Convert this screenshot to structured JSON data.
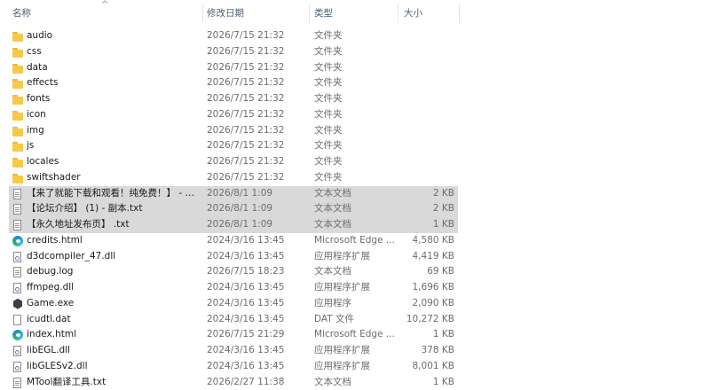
{
  "header": {
    "name": "名称",
    "date": "修改日期",
    "type": "类型",
    "size": "大小",
    "sort_indicator": "^"
  },
  "rows": [
    {
      "name": "audio",
      "date": "2026/7/15 21:32",
      "type": "文件夹",
      "size": "",
      "icon": "folder-icon",
      "selected": false
    },
    {
      "name": "css",
      "date": "2026/7/15 21:32",
      "type": "文件夹",
      "size": "",
      "icon": "folder-icon",
      "selected": false
    },
    {
      "name": "data",
      "date": "2026/7/15 21:32",
      "type": "文件夹",
      "size": "",
      "icon": "folder-icon",
      "selected": false
    },
    {
      "name": "effects",
      "date": "2026/7/15 21:32",
      "type": "文件夹",
      "size": "",
      "icon": "folder-icon",
      "selected": false
    },
    {
      "name": "fonts",
      "date": "2026/7/15 21:32",
      "type": "文件夹",
      "size": "",
      "icon": "folder-icon",
      "selected": false
    },
    {
      "name": "icon",
      "date": "2026/7/15 21:32",
      "type": "文件夹",
      "size": "",
      "icon": "folder-icon",
      "selected": false
    },
    {
      "name": "img",
      "date": "2026/7/15 21:32",
      "type": "文件夹",
      "size": "",
      "icon": "folder-icon",
      "selected": false
    },
    {
      "name": "js",
      "date": "2026/7/15 21:32",
      "type": "文件夹",
      "size": "",
      "icon": "folder-icon",
      "selected": false
    },
    {
      "name": "locales",
      "date": "2026/7/15 21:32",
      "type": "文件夹",
      "size": "",
      "icon": "folder-icon",
      "selected": false
    },
    {
      "name": "swiftshader",
      "date": "2026/7/15 21:32",
      "type": "文件夹",
      "size": "",
      "icon": "folder-icon",
      "selected": false
    },
    {
      "name": "【来了就能下载和观看！纯免费！】 - 副...",
      "date": "2026/8/1 1:09",
      "type": "文本文档",
      "size": "2 KB",
      "icon": "text-file-icon",
      "selected": true
    },
    {
      "name": "【论坛介绍】 (1) - 副本.txt",
      "date": "2026/8/1 1:09",
      "type": "文本文档",
      "size": "2 KB",
      "icon": "text-file-icon",
      "selected": true
    },
    {
      "name": "【永久地址发布页】 .txt",
      "date": "2026/8/1 1:09",
      "type": "文本文档",
      "size": "1 KB",
      "icon": "text-file-icon",
      "selected": true
    },
    {
      "name": "credits.html",
      "date": "2024/3/16 13:45",
      "type": "Microsoft Edge ...",
      "size": "4,580 KB",
      "icon": "edge-icon",
      "selected": false
    },
    {
      "name": "d3dcompiler_47.dll",
      "date": "2024/3/16 13:45",
      "type": "应用程序扩展",
      "size": "4,419 KB",
      "icon": "dll-file-icon",
      "selected": false
    },
    {
      "name": "debug.log",
      "date": "2026/7/15 18:23",
      "type": "文本文档",
      "size": "69 KB",
      "icon": "text-file-icon",
      "selected": false
    },
    {
      "name": "ffmpeg.dll",
      "date": "2024/3/16 13:45",
      "type": "应用程序扩展",
      "size": "1,696 KB",
      "icon": "dll-file-icon",
      "selected": false
    },
    {
      "name": "Game.exe",
      "date": "2024/3/16 13:45",
      "type": "应用程序",
      "size": "2,090 KB",
      "icon": "exe-icon",
      "selected": false
    },
    {
      "name": "icudtl.dat",
      "date": "2024/3/16 13:45",
      "type": "DAT 文件",
      "size": "10,272 KB",
      "icon": "blank-file-icon",
      "selected": false
    },
    {
      "name": "index.html",
      "date": "2026/7/15 21:29",
      "type": "Microsoft Edge ...",
      "size": "1 KB",
      "icon": "edge-icon",
      "selected": false
    },
    {
      "name": "libEGL.dll",
      "date": "2024/3/16 13:45",
      "type": "应用程序扩展",
      "size": "378 KB",
      "icon": "dll-file-icon",
      "selected": false
    },
    {
      "name": "libGLESv2.dll",
      "date": "2024/3/16 13:45",
      "type": "应用程序扩展",
      "size": "8,001 KB",
      "icon": "dll-file-icon",
      "selected": false
    },
    {
      "name": "MTool翻译工具.txt",
      "date": "2026/2/27 11:38",
      "type": "文本文档",
      "size": "1 KB",
      "icon": "text-file-icon",
      "selected": false
    }
  ]
}
